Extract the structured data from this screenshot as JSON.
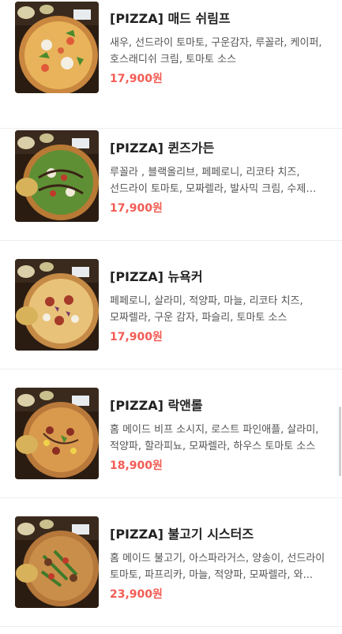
{
  "menu": {
    "items": [
      {
        "title": "[PIZZA] 매드 쉬림프",
        "description": "새우, 선드라이 토마토, 구운감자, 루꼴라, 케이퍼, 호스래디쉬 크림, 토마토 소스",
        "price": "17,900원",
        "image_icon": "pizza-photo-icon"
      },
      {
        "title": "[PIZZA] 퀸즈가든",
        "description": "루꼴라 , 블랙올리브, 페페로니, 리코타 치즈, 선드라이 토마토, 모짜렐라, 발사믹 크림, 수제 토마...",
        "price": "17,900원",
        "image_icon": "pizza-photo-icon"
      },
      {
        "title": "[PIZZA] 뉴욕커",
        "description": "페페로니, 살라미, 적양파, 마늘, 리코타 치즈, 모짜렐라, 구운 감자, 파슬리, 토마토 소스",
        "price": "17,900원",
        "image_icon": "pizza-photo-icon"
      },
      {
        "title": "[PIZZA] 락앤롤",
        "description": "홈 메이드 비프 소시지, 로스트 파인애플, 살라미, 적양파, 할라피뇨, 모짜렐라, 하우스 토마토 소스",
        "price": "18,900원",
        "image_icon": "pizza-photo-icon"
      },
      {
        "title": "[PIZZA] 불고기 시스터즈",
        "description": "홈 메이드 불고기, 아스파라거스, 양송이, 선드라이 토마토, 파프리카, 마늘, 적양파, 모짜렐라, 와...",
        "price": "23,900원",
        "image_icon": "pizza-photo-icon"
      }
    ]
  },
  "colors": {
    "price": "#f25c54",
    "title": "#222222",
    "description": "#555555",
    "divider": "#eeeeee"
  }
}
